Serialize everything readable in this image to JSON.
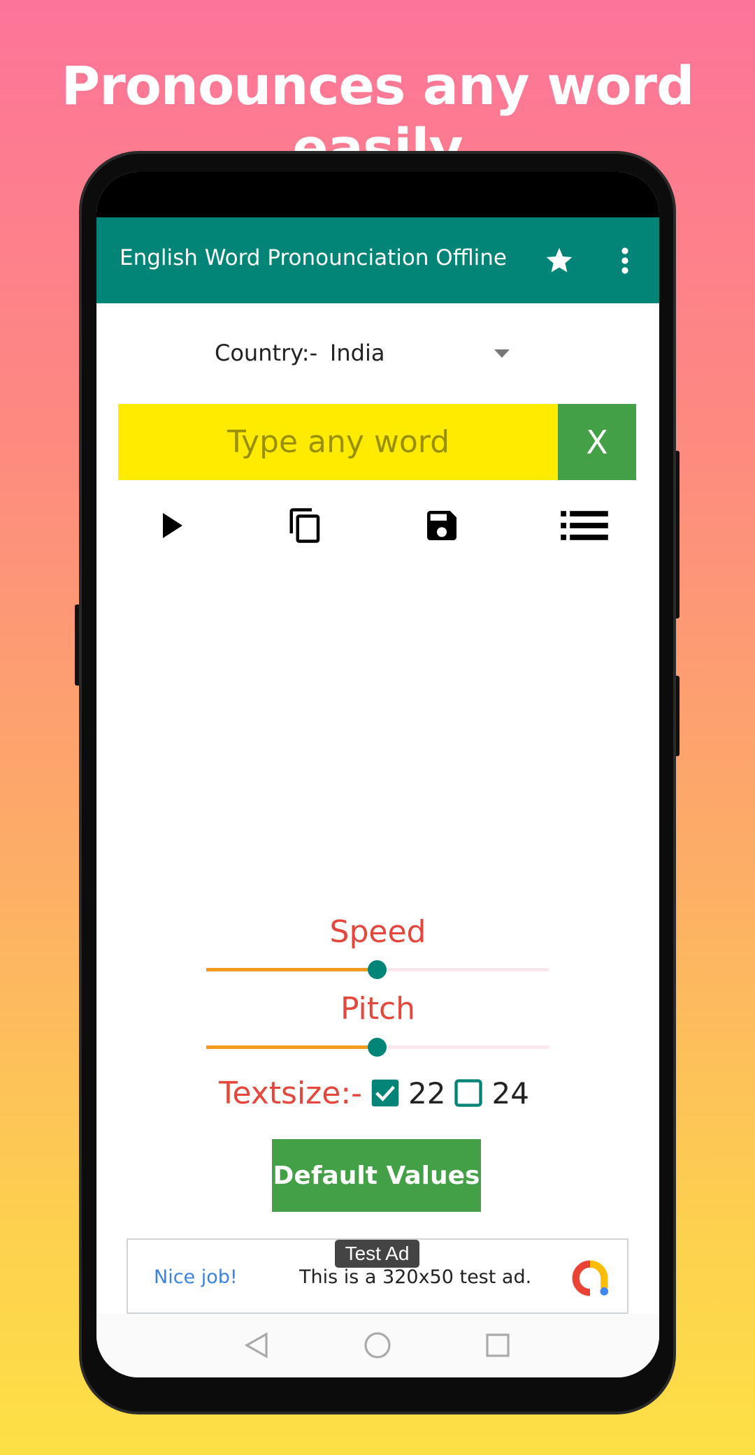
{
  "headline": "Pronounces any word easily",
  "app_bar": {
    "title": "English Word Pronounciation Offline",
    "icons": [
      "star-icon",
      "more-vert-icon"
    ]
  },
  "country": {
    "label": "Country:-",
    "value": "India"
  },
  "word_input": {
    "placeholder": "Type any word",
    "value": "",
    "clear_label": "X"
  },
  "actions": [
    "play-icon",
    "copy-icon",
    "save-icon",
    "list-icon"
  ],
  "speed": {
    "label": "Speed",
    "value_fraction": 0.5
  },
  "pitch": {
    "label": "Pitch",
    "value_fraction": 0.5
  },
  "textsize": {
    "label": "Textsize:-",
    "options": [
      {
        "label": "22",
        "checked": true
      },
      {
        "label": "24",
        "checked": false
      }
    ]
  },
  "default_button": "Default Values",
  "ad": {
    "badge": "Test Ad",
    "headline": "Nice job!",
    "text": "This is a 320x50 test ad."
  },
  "colors": {
    "appbar": "#028576",
    "input_bg": "#ffeb00",
    "button": "#43a047",
    "label": "#e5473c",
    "slider_fill": "#f29b1e"
  }
}
